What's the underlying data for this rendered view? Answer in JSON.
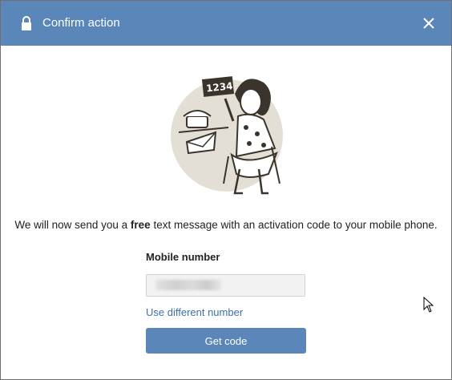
{
  "dialog": {
    "title": "Confirm action",
    "icons": {
      "title": "lock-icon",
      "close": "close-icon"
    },
    "colors": {
      "header": "#5b86ba",
      "button": "#5b86ba",
      "link": "#3f6fa4"
    }
  },
  "message": {
    "before": "We will now send you a ",
    "emphasis": "free",
    "after": " text message with an activation code to your mobile phone."
  },
  "form": {
    "mobile_label": "Mobile number",
    "mobile_value": "",
    "different_number_link": "Use different number",
    "get_code_label": "Get code"
  },
  "illustration": {
    "sign_text": "1234"
  }
}
